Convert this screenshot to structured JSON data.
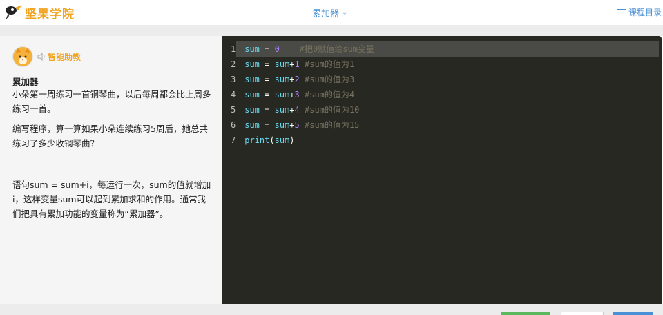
{
  "header": {
    "logo_text": "坚果学院",
    "lesson_title": "累加器",
    "catalog_label": "课程目录"
  },
  "assistant": {
    "label": "智能助教"
  },
  "lesson": {
    "title": "累加器",
    "paragraph1": "小朵第一周练习一首钢琴曲，以后每周都会比上周多练习一首。",
    "paragraph2": "编写程序，算一算如果小朵连续练习5周后，她总共练习了多少收钢琴曲？",
    "paragraph3": "语句sum = sum+i，每运行一次，sum的值就增加i，这样变量sum可以起到累加求和的作用。通常我们把具有累加功能的变量称为“累加器”。"
  },
  "code": {
    "lines": [
      {
        "n": "1",
        "var": "sum",
        "eq": " = ",
        "rhs": "0",
        "spacer": "    ",
        "comment": "#把0赋值给sum变量"
      },
      {
        "n": "2",
        "var": "sum",
        "eq": " = ",
        "rhs": "sum",
        "plus": "+",
        "k": "1",
        "spacer": " ",
        "comment": "#sum的值为1"
      },
      {
        "n": "3",
        "var": "sum",
        "eq": " = ",
        "rhs": "sum",
        "plus": "+",
        "k": "2",
        "spacer": " ",
        "comment": "#sum的值为3"
      },
      {
        "n": "4",
        "var": "sum",
        "eq": " = ",
        "rhs": "sum",
        "plus": "+",
        "k": "3",
        "spacer": " ",
        "comment": "#sum的值为4"
      },
      {
        "n": "5",
        "var": "sum",
        "eq": " = ",
        "rhs": "sum",
        "plus": "+",
        "k": "4",
        "spacer": " ",
        "comment": "#sum的值为10"
      },
      {
        "n": "6",
        "var": "sum",
        "eq": " = ",
        "rhs": "sum",
        "plus": "+",
        "k": "5",
        "spacer": " ",
        "comment": "#sum的值为15"
      },
      {
        "n": "7",
        "fn": "print",
        "open": "(",
        "arg": "sum",
        "close": ")"
      }
    ]
  },
  "theme": {
    "accent": "#f0a422",
    "link": "#4a90d6",
    "editor_bg": "#272822"
  }
}
